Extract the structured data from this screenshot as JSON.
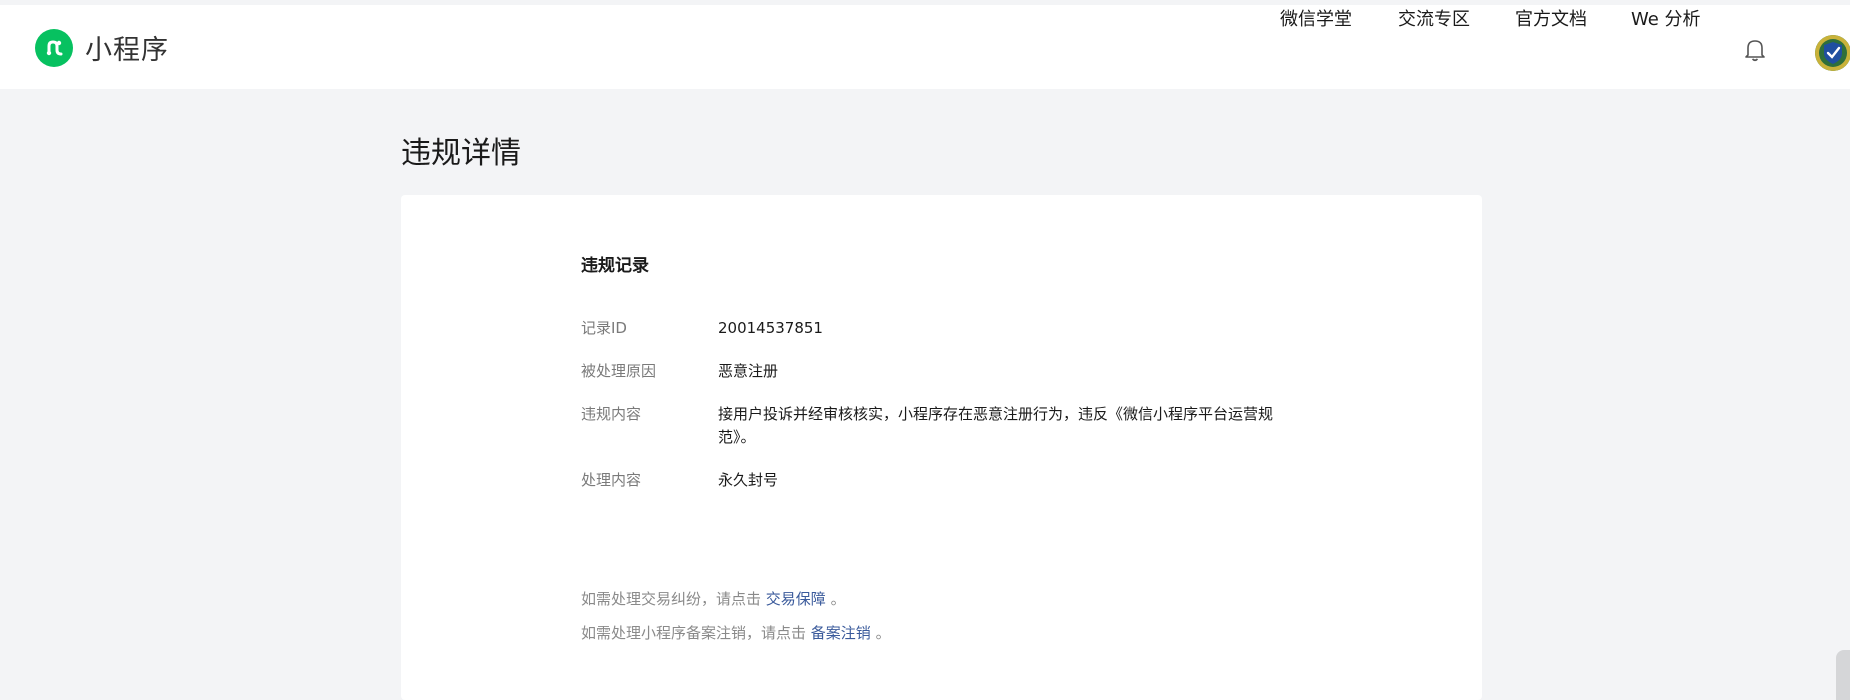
{
  "brand": {
    "name": "小程序",
    "color": "#07c160",
    "icon": "miniprogram-link-icon"
  },
  "nav": [
    "微信学堂",
    "交流专区",
    "官方文档",
    "We 分析"
  ],
  "header_icons": {
    "bell": "bell-icon",
    "avatar": "shield-avatar-icon"
  },
  "page": {
    "title": "违规详情"
  },
  "record": {
    "section_title": "违规记录",
    "rows": [
      {
        "label": "记录ID",
        "value": "20014537851"
      },
      {
        "label": "被处理原因",
        "value": "恶意注册"
      },
      {
        "label": "违规内容",
        "value": "接用户投诉并经审核核实，小程序存在恶意注册行为，违反《微信小程序平台运营规范》。"
      },
      {
        "label": "处理内容",
        "value": "永久封号"
      }
    ]
  },
  "notes": [
    {
      "prefix": "如需处理交易纠纷，请点击 ",
      "link": "交易保障",
      "suffix": " 。"
    },
    {
      "prefix": "如需处理小程序备案注销，请点击 ",
      "link": "备案注销",
      "suffix": " 。"
    }
  ],
  "colors": {
    "link": "#3a5a9b",
    "background": "#f3f4f6",
    "label": "#7a7a7a"
  }
}
